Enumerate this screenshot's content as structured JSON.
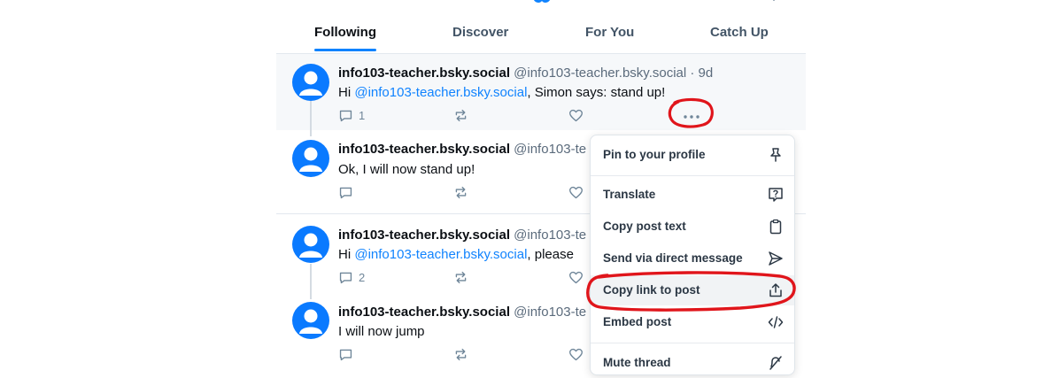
{
  "tabs": [
    {
      "label": "Following",
      "active": true
    },
    {
      "label": "Discover",
      "active": false
    },
    {
      "label": "For You",
      "active": false
    },
    {
      "label": "Catch Up",
      "active": false
    }
  ],
  "posts": [
    {
      "name": "info103-teacher.bsky.social",
      "handle": "@info103-teacher.bsky.social · 9d",
      "text_before": "Hi ",
      "mention": "@info103-teacher.bsky.social",
      "text_after": ", Simon says: stand up!",
      "reply_count": "1"
    },
    {
      "name": "info103-teacher.bsky.social",
      "handle": "@info103-te",
      "text": "Ok, I will now stand up!"
    },
    {
      "name": "info103-teacher.bsky.social",
      "handle": "@info103-te",
      "text_before": "Hi ",
      "mention": "@info103-teacher.bsky.social",
      "text_after": ", please",
      "reply_count": "2"
    },
    {
      "name": "info103-teacher.bsky.social",
      "handle": "@info103-te",
      "text": "I will now jump"
    }
  ],
  "menu": {
    "items": [
      {
        "label": "Pin to your profile",
        "icon": "pin-icon"
      },
      {
        "label": "Translate",
        "icon": "translate-icon"
      },
      {
        "label": "Copy post text",
        "icon": "clipboard-icon"
      },
      {
        "label": "Send via direct message",
        "icon": "send-icon"
      },
      {
        "label": "Copy link to post",
        "icon": "share-icon",
        "highlighted": true
      },
      {
        "label": "Embed post",
        "icon": "code-icon"
      },
      {
        "label": "Mute thread",
        "icon": "mute-icon"
      }
    ]
  },
  "colors": {
    "accent": "#1083fe",
    "annotation": "#e0151b"
  }
}
